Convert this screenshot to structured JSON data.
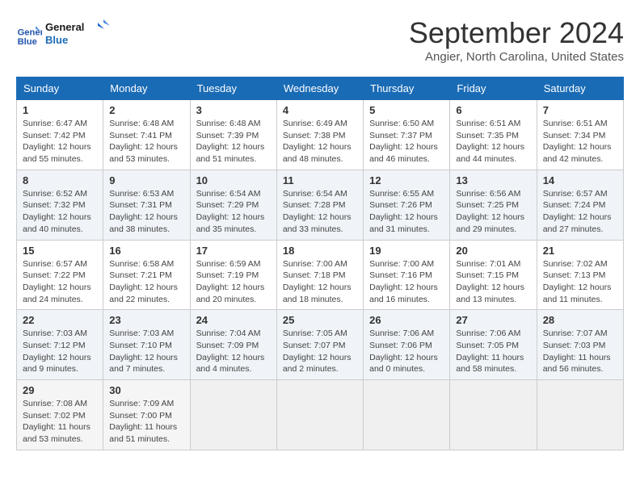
{
  "logo": {
    "line1": "General",
    "line2": "Blue"
  },
  "title": "September 2024",
  "subtitle": "Angier, North Carolina, United States",
  "weekdays": [
    "Sunday",
    "Monday",
    "Tuesday",
    "Wednesday",
    "Thursday",
    "Friday",
    "Saturday"
  ],
  "weeks": [
    [
      {
        "day": "1",
        "sunrise": "6:47 AM",
        "sunset": "7:42 PM",
        "daylight": "12 hours and 55 minutes."
      },
      {
        "day": "2",
        "sunrise": "6:48 AM",
        "sunset": "7:41 PM",
        "daylight": "12 hours and 53 minutes."
      },
      {
        "day": "3",
        "sunrise": "6:48 AM",
        "sunset": "7:39 PM",
        "daylight": "12 hours and 51 minutes."
      },
      {
        "day": "4",
        "sunrise": "6:49 AM",
        "sunset": "7:38 PM",
        "daylight": "12 hours and 48 minutes."
      },
      {
        "day": "5",
        "sunrise": "6:50 AM",
        "sunset": "7:37 PM",
        "daylight": "12 hours and 46 minutes."
      },
      {
        "day": "6",
        "sunrise": "6:51 AM",
        "sunset": "7:35 PM",
        "daylight": "12 hours and 44 minutes."
      },
      {
        "day": "7",
        "sunrise": "6:51 AM",
        "sunset": "7:34 PM",
        "daylight": "12 hours and 42 minutes."
      }
    ],
    [
      {
        "day": "8",
        "sunrise": "6:52 AM",
        "sunset": "7:32 PM",
        "daylight": "12 hours and 40 minutes."
      },
      {
        "day": "9",
        "sunrise": "6:53 AM",
        "sunset": "7:31 PM",
        "daylight": "12 hours and 38 minutes."
      },
      {
        "day": "10",
        "sunrise": "6:54 AM",
        "sunset": "7:29 PM",
        "daylight": "12 hours and 35 minutes."
      },
      {
        "day": "11",
        "sunrise": "6:54 AM",
        "sunset": "7:28 PM",
        "daylight": "12 hours and 33 minutes."
      },
      {
        "day": "12",
        "sunrise": "6:55 AM",
        "sunset": "7:26 PM",
        "daylight": "12 hours and 31 minutes."
      },
      {
        "day": "13",
        "sunrise": "6:56 AM",
        "sunset": "7:25 PM",
        "daylight": "12 hours and 29 minutes."
      },
      {
        "day": "14",
        "sunrise": "6:57 AM",
        "sunset": "7:24 PM",
        "daylight": "12 hours and 27 minutes."
      }
    ],
    [
      {
        "day": "15",
        "sunrise": "6:57 AM",
        "sunset": "7:22 PM",
        "daylight": "12 hours and 24 minutes."
      },
      {
        "day": "16",
        "sunrise": "6:58 AM",
        "sunset": "7:21 PM",
        "daylight": "12 hours and 22 minutes."
      },
      {
        "day": "17",
        "sunrise": "6:59 AM",
        "sunset": "7:19 PM",
        "daylight": "12 hours and 20 minutes."
      },
      {
        "day": "18",
        "sunrise": "7:00 AM",
        "sunset": "7:18 PM",
        "daylight": "12 hours and 18 minutes."
      },
      {
        "day": "19",
        "sunrise": "7:00 AM",
        "sunset": "7:16 PM",
        "daylight": "12 hours and 16 minutes."
      },
      {
        "day": "20",
        "sunrise": "7:01 AM",
        "sunset": "7:15 PM",
        "daylight": "12 hours and 13 minutes."
      },
      {
        "day": "21",
        "sunrise": "7:02 AM",
        "sunset": "7:13 PM",
        "daylight": "12 hours and 11 minutes."
      }
    ],
    [
      {
        "day": "22",
        "sunrise": "7:03 AM",
        "sunset": "7:12 PM",
        "daylight": "12 hours and 9 minutes."
      },
      {
        "day": "23",
        "sunrise": "7:03 AM",
        "sunset": "7:10 PM",
        "daylight": "12 hours and 7 minutes."
      },
      {
        "day": "24",
        "sunrise": "7:04 AM",
        "sunset": "7:09 PM",
        "daylight": "12 hours and 4 minutes."
      },
      {
        "day": "25",
        "sunrise": "7:05 AM",
        "sunset": "7:07 PM",
        "daylight": "12 hours and 2 minutes."
      },
      {
        "day": "26",
        "sunrise": "7:06 AM",
        "sunset": "7:06 PM",
        "daylight": "12 hours and 0 minutes."
      },
      {
        "day": "27",
        "sunrise": "7:06 AM",
        "sunset": "7:05 PM",
        "daylight": "11 hours and 58 minutes."
      },
      {
        "day": "28",
        "sunrise": "7:07 AM",
        "sunset": "7:03 PM",
        "daylight": "11 hours and 56 minutes."
      }
    ],
    [
      {
        "day": "29",
        "sunrise": "7:08 AM",
        "sunset": "7:02 PM",
        "daylight": "11 hours and 53 minutes."
      },
      {
        "day": "30",
        "sunrise": "7:09 AM",
        "sunset": "7:00 PM",
        "daylight": "11 hours and 51 minutes."
      },
      null,
      null,
      null,
      null,
      null
    ]
  ]
}
